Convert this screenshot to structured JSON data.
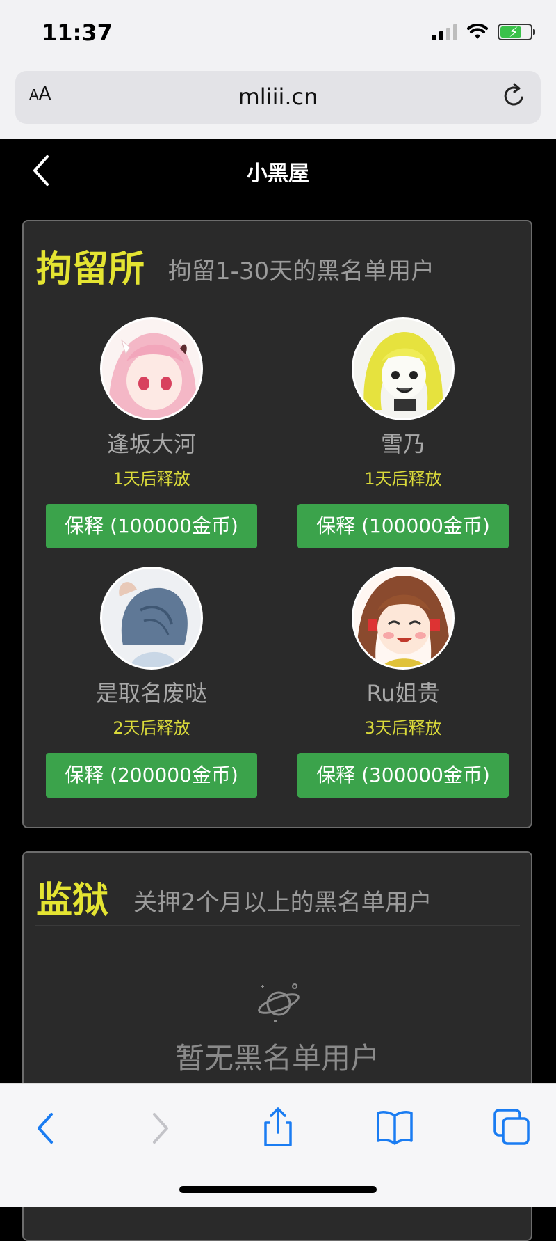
{
  "status_bar": {
    "time": "11:37"
  },
  "browser": {
    "aa_label_small": "A",
    "aa_label_large": "A",
    "url": "mliii.cn"
  },
  "header": {
    "title": "小黑屋"
  },
  "detention": {
    "title": "拘留所",
    "subtitle": "拘留1-30天的黑名单用户",
    "users": [
      {
        "name": "逢坂大河",
        "release": "1天后释放",
        "bail": "保释 (100000金币)",
        "avatar": "pink-hair-anime-avatar"
      },
      {
        "name": "雪乃",
        "release": "1天后释放",
        "bail": "保释 (100000金币)",
        "avatar": "blonde-manga-avatar"
      },
      {
        "name": "是取名废哒",
        "release": "2天后释放",
        "bail": "保释 (200000金币)",
        "avatar": "blue-hair-avatar"
      },
      {
        "name": "Ru姐贵",
        "release": "3天后释放",
        "bail": "保释 (300000金币)",
        "avatar": "crying-anime-avatar"
      }
    ]
  },
  "prison": {
    "title": "监狱",
    "subtitle": "关押2个月以上的黑名单用户",
    "empty_text": "暂无黑名单用户",
    "empty_icon": "planet-icon"
  },
  "toolbar": {
    "icons": [
      "back-icon",
      "forward-icon",
      "share-icon",
      "bookmarks-icon",
      "tabs-icon"
    ]
  },
  "colors": {
    "accent_yellow": "#e4e432",
    "button_green": "#3ba34b",
    "safari_blue": "#1a7cf2"
  }
}
